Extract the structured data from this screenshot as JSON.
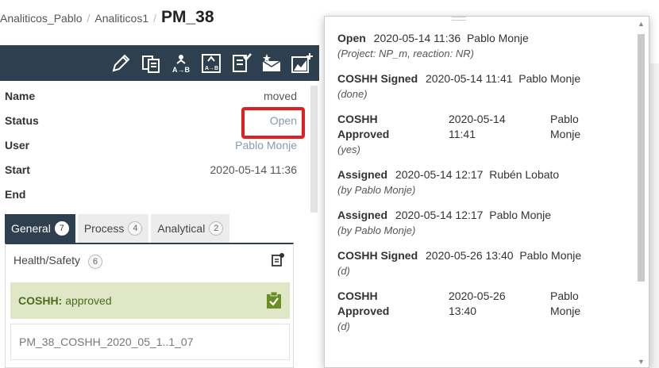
{
  "breadcrumb": {
    "items": [
      "Analiticos_Pablo",
      "Analiticos1"
    ],
    "current": "PM_38"
  },
  "toolbar": {
    "icons": [
      "edit-pencil-icon",
      "copy-document-icon",
      "transfer-a-to-b-icon",
      "upload-a-to-b-icon",
      "checklist-icon",
      "mail-star-icon",
      "add-chart-icon"
    ]
  },
  "properties": {
    "name_label": "Name",
    "name_value": "moved",
    "status_label": "Status",
    "status_value": "Open",
    "user_label": "User",
    "user_value": "Pablo Monje",
    "start_label": "Start",
    "start_value": "2020-05-14 11:36",
    "end_label": "End",
    "end_value": ""
  },
  "tabs": [
    {
      "label": "General",
      "count": "7",
      "active": true
    },
    {
      "label": "Process",
      "count": "4",
      "active": false
    },
    {
      "label": "Analytical",
      "count": "2",
      "active": false
    }
  ],
  "panel": {
    "section_label": "Health/Safety",
    "section_count": "6",
    "coshh_label": "COSHH:",
    "coshh_status": "approved",
    "file_name": "PM_38_COSHH_2020_05_1..1_07"
  },
  "history": [
    {
      "state": "Open",
      "date": "2020-05-14 11:36",
      "user": "Pablo Monje",
      "note": "(Project: NP_m, reaction: NR)"
    },
    {
      "state": "COSHH Signed",
      "date": "2020-05-14 11:41",
      "user": "Pablo Monje",
      "note": "(done)"
    },
    {
      "state": "COSHH Approved",
      "date": "2020-05-14 11:41",
      "user": "Pablo Monje",
      "note": "(yes)"
    },
    {
      "state": "Assigned",
      "date": "2020-05-14 12:17",
      "user": "Rubén Lobato",
      "note": "(by Pablo Monje)"
    },
    {
      "state": "Assigned",
      "date": "2020-05-14 12:17",
      "user": "Pablo Monje",
      "note": "(by Pablo Monje)"
    },
    {
      "state": "COSHH Signed",
      "date": "2020-05-26 13:40",
      "user": "Pablo Monje",
      "note": "(d)"
    },
    {
      "state": "COSHH Approved",
      "date": "2020-05-26 13:40",
      "user": "Pablo Monje",
      "note": "(d)"
    }
  ],
  "colors": {
    "toolbar": "#2e3f4f",
    "highlight": "#e02020",
    "coshh_bg": "#dfe7c6"
  }
}
